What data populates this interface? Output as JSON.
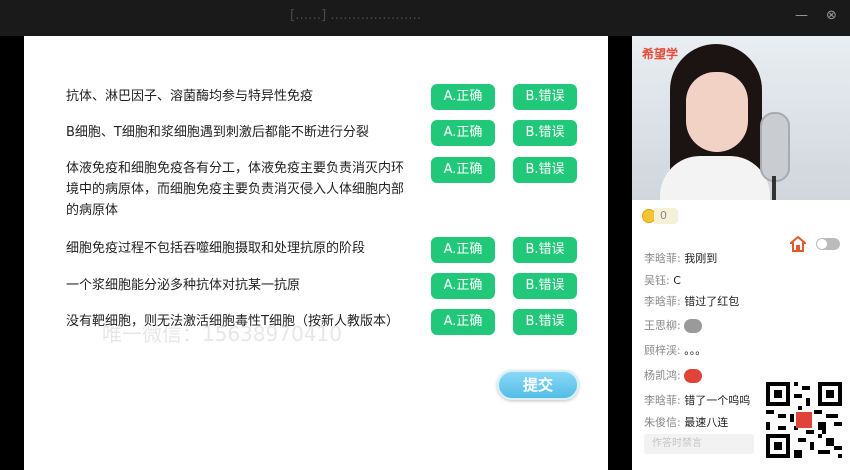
{
  "window": {
    "title": "[……] …………………"
  },
  "quiz": {
    "questions": [
      {
        "text": "抗体、淋巴因子、溶菌酶均参与特异性免疫",
        "option_a": "A.正确",
        "option_b": "B.错误"
      },
      {
        "text": "B细胞、T细胞和浆细胞遇到刺激后都能不断进行分裂",
        "option_a": "A.正确",
        "option_b": "B.错误"
      },
      {
        "text_lines": [
          "体液免疫和细胞免疫各有分工，体液免疫主要负责消灭内环",
          "境中的病原体，而细胞免疫主要负责消灭侵入人体细胞内部",
          "的病原体"
        ],
        "option_a": "A.正确",
        "option_b": "B.错误"
      },
      {
        "text": "细胞免疫过程不包括吞噬细胞摄取和处理抗原的阶段",
        "option_a": "A.正确",
        "option_b": "B.错误"
      },
      {
        "text": "一个浆细胞能分泌多种抗体对抗某一抗原",
        "option_a": "A.正确",
        "option_b": "B.错误"
      },
      {
        "text": "没有靶细胞，则无法激活细胞毒性T细胞（按新人教版本）",
        "option_a": "A.正确",
        "option_b": "B.错误"
      }
    ],
    "watermark": "唯一微信：15638970410",
    "submit_label": "提交"
  },
  "video": {
    "logo": "希望学"
  },
  "chat": {
    "coin_count": "0",
    "messages": [
      {
        "name": "李晗菲:",
        "text": "我刚到"
      },
      {
        "name": "吴钰:",
        "text": "C"
      },
      {
        "name": "李晗菲:",
        "text": "错过了红包"
      },
      {
        "name": "王思柳:",
        "emoji": "grey-face-emoji"
      },
      {
        "name": "顾梓渓:",
        "text": "。。。"
      },
      {
        "name": "杨凯鸿:",
        "emoji": "red-lips-emoji"
      },
      {
        "name": "李晗菲:",
        "text": "错了一个呜呜"
      },
      {
        "name": "朱俊信:",
        "text": "最速八连"
      }
    ],
    "input_placeholder": "作答时禁言"
  },
  "colors": {
    "answer_button": "#22c87a",
    "submit_button": "#53bde6",
    "brand": "#e74b3c"
  }
}
